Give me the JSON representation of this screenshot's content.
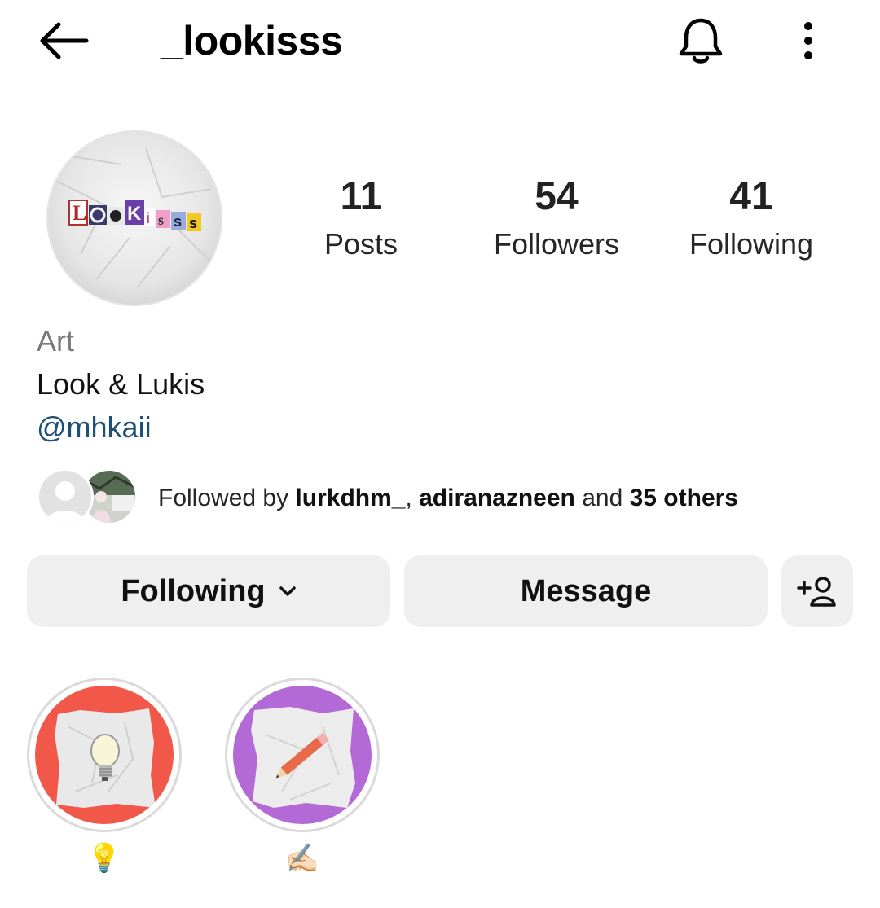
{
  "header": {
    "username": "_lookisss"
  },
  "profile": {
    "avatar_text": "LooKisss",
    "stats": [
      {
        "value": "11",
        "label": "Posts"
      },
      {
        "value": "54",
        "label": "Followers"
      },
      {
        "value": "41",
        "label": "Following"
      }
    ],
    "category": "Art",
    "bio": "Look & Lukis",
    "mention": "@mhkaii"
  },
  "followed_by": {
    "prefix": "Followed by ",
    "user1": "lurkdhm_",
    "sep": ", ",
    "user2": "adiranazneen",
    "mid": " and ",
    "others": "35 others"
  },
  "actions": {
    "following_label": "Following",
    "message_label": "Message"
  },
  "highlights": [
    {
      "label": "💡",
      "bg_color": "#f2584a"
    },
    {
      "label": "✍🏻",
      "bg_color": "#b36ad6"
    }
  ]
}
